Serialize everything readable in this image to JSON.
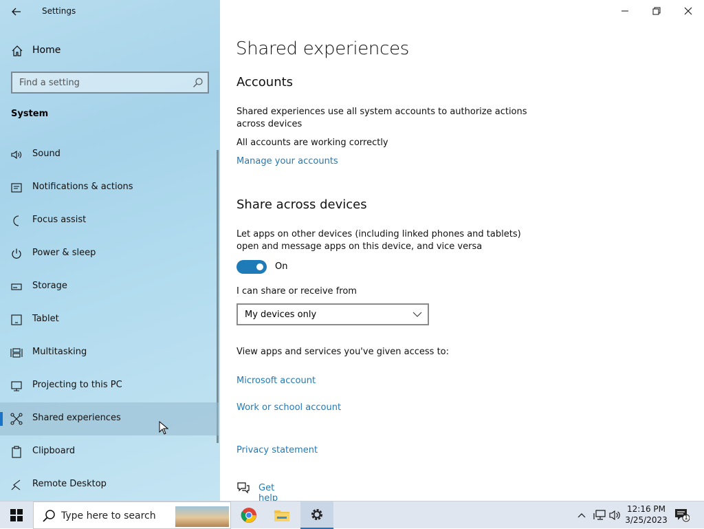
{
  "window": {
    "app_title": "Settings",
    "back_icon": "back-arrow-icon",
    "controls": [
      "minimize",
      "restore",
      "close"
    ]
  },
  "sidebar": {
    "home_label": "Home",
    "search_placeholder": "Find a setting",
    "section_title": "System",
    "items": [
      {
        "label": "Sound",
        "icon": "speaker-icon"
      },
      {
        "label": "Notifications & actions",
        "icon": "notifications-icon"
      },
      {
        "label": "Focus assist",
        "icon": "moon-icon"
      },
      {
        "label": "Power & sleep",
        "icon": "power-icon"
      },
      {
        "label": "Storage",
        "icon": "storage-icon"
      },
      {
        "label": "Tablet",
        "icon": "tablet-icon"
      },
      {
        "label": "Multitasking",
        "icon": "multitasking-icon"
      },
      {
        "label": "Projecting to this PC",
        "icon": "projecting-icon"
      },
      {
        "label": "Shared experiences",
        "icon": "shared-experiences-icon",
        "selected": true
      },
      {
        "label": "Clipboard",
        "icon": "clipboard-icon"
      },
      {
        "label": "Remote Desktop",
        "icon": "remote-desktop-icon"
      }
    ]
  },
  "main": {
    "title": "Shared experiences",
    "accounts": {
      "heading": "Accounts",
      "description": "Shared experiences use all system accounts to authorize actions across devices",
      "status": "All accounts are working correctly",
      "manage_link": "Manage your accounts"
    },
    "share": {
      "heading": "Share across devices",
      "description": "Let apps on other devices (including linked phones and tablets) open and message apps on this device, and vice versa",
      "toggle_state": "On",
      "toggle_on": true,
      "share_from_label": "I can share or receive from",
      "share_from_value": "My devices only",
      "view_access_label": "View apps and services you've given access to:",
      "microsoft_account_link": "Microsoft account",
      "work_school_link": "Work or school account"
    },
    "privacy_link": "Privacy statement",
    "help_link": "Get help"
  },
  "taskbar": {
    "search_placeholder": "Type here to search",
    "apps": [
      "chrome-icon",
      "file-explorer-icon",
      "settings-icon"
    ],
    "clock": {
      "time": "12:16 PM",
      "date": "3/25/2023"
    },
    "notification_count": "1"
  },
  "colors": {
    "accent": "#1f7ab8",
    "sidebar": "#b3dcef",
    "taskbar": "#dfe6f0"
  }
}
